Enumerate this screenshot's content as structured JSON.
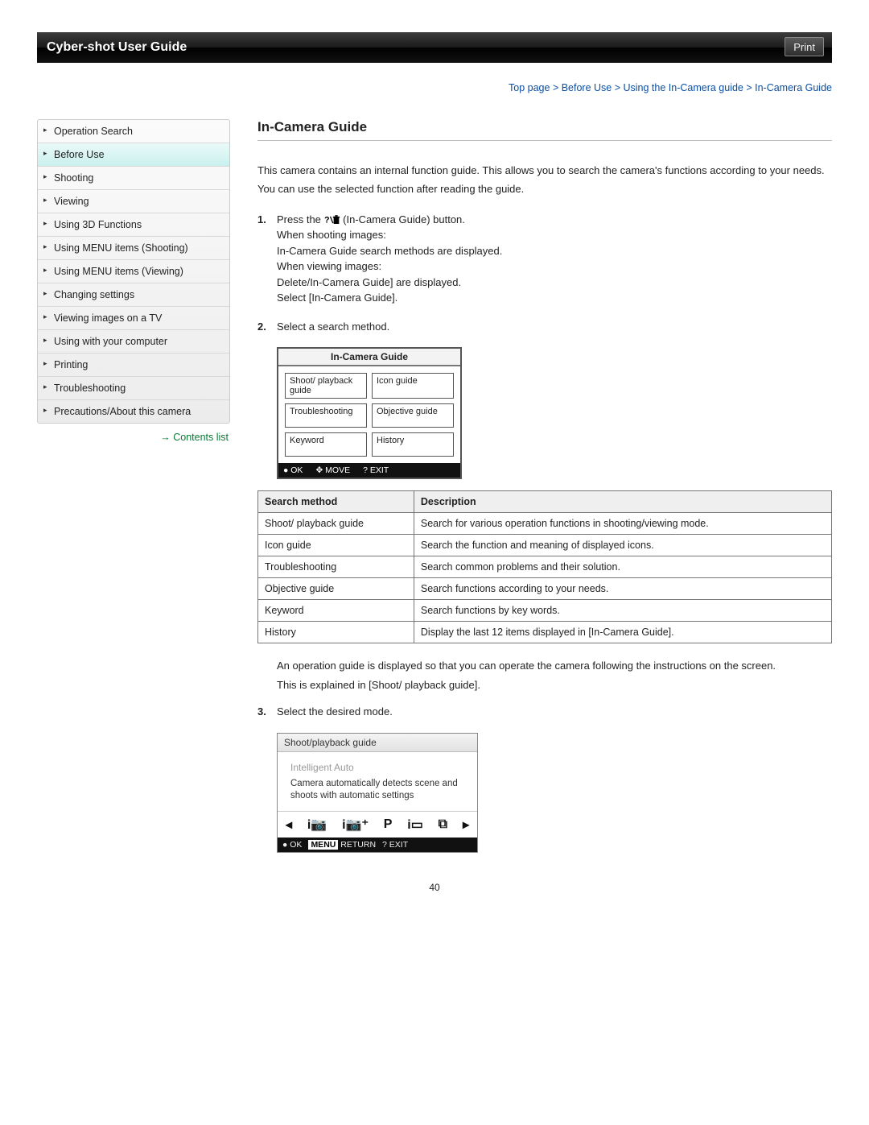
{
  "header": {
    "title": "Cyber-shot User Guide",
    "print": "Print"
  },
  "breadcrumb": "Top page > Before Use > Using the In-Camera guide > In-Camera Guide",
  "sidebar": {
    "items": [
      {
        "label": "Operation Search",
        "active": false
      },
      {
        "label": "Before Use",
        "active": true
      },
      {
        "label": "Shooting",
        "active": false
      },
      {
        "label": "Viewing",
        "active": false
      },
      {
        "label": "Using 3D Functions",
        "active": false
      },
      {
        "label": "Using MENU items (Shooting)",
        "active": false
      },
      {
        "label": "Using MENU items (Viewing)",
        "active": false
      },
      {
        "label": "Changing settings",
        "active": false
      },
      {
        "label": "Viewing images on a TV",
        "active": false
      },
      {
        "label": "Using with your computer",
        "active": false
      },
      {
        "label": "Printing",
        "active": false
      },
      {
        "label": "Troubleshooting",
        "active": false
      },
      {
        "label": "Precautions/About this camera",
        "active": false
      }
    ],
    "contents_link": "Contents list"
  },
  "main": {
    "title": "In-Camera Guide",
    "intro": {
      "p1": "This camera contains an internal function guide. This allows you to search the camera's functions according to your needs.",
      "p2": "You can use the selected function after reading the guide."
    },
    "steps": {
      "s1": {
        "num": "1.",
        "line1a": "Press the ",
        "line1b": " (In-Camera Guide) button.",
        "l2": "When shooting images:",
        "l3": "In-Camera Guide search methods are displayed.",
        "l4": "When viewing images:",
        "l5": "Delete/In-Camera Guide] are displayed.",
        "l6": "Select [In-Camera Guide]."
      },
      "s2": {
        "num": "2.",
        "text": "Select a search method."
      },
      "s3": {
        "num": "3.",
        "text": "Select the desired mode."
      }
    },
    "ui1": {
      "title": "In-Camera Guide",
      "cells": [
        "Shoot/ playback guide",
        "Icon guide",
        "Troubleshooting",
        "Objective guide",
        "Keyword",
        "History"
      ],
      "bottom": {
        "ok": "OK",
        "move": "MOVE",
        "exit": "EXIT"
      }
    },
    "table": {
      "head": {
        "c1": "Search method",
        "c2": "Description"
      },
      "rows": [
        {
          "c1": "Shoot/ playback guide",
          "c2": "Search for various operation functions in shooting/viewing mode."
        },
        {
          "c1": "Icon guide",
          "c2": "Search the function and meaning of displayed icons."
        },
        {
          "c1": "Troubleshooting",
          "c2": "Search common problems and their solution."
        },
        {
          "c1": "Objective guide",
          "c2": "Search functions according to your needs."
        },
        {
          "c1": "Keyword",
          "c2": "Search functions by key words."
        },
        {
          "c1": "History",
          "c2": "Display the last 12 items displayed in [In-Camera Guide]."
        }
      ]
    },
    "extra": {
      "p1": "An operation guide is displayed so that you can operate the camera following the instructions on the screen.",
      "p2": "This is explained in [Shoot/ playback guide]."
    },
    "ui2": {
      "header": "Shoot/playback guide",
      "title": "Intelligent Auto",
      "desc": "Camera automatically detects scene and shoots with automatic settings",
      "footer": {
        "ok": "OK",
        "ret": "RETURN",
        "exit": "EXIT",
        "menu": "MENU"
      }
    }
  },
  "page_number": "40"
}
